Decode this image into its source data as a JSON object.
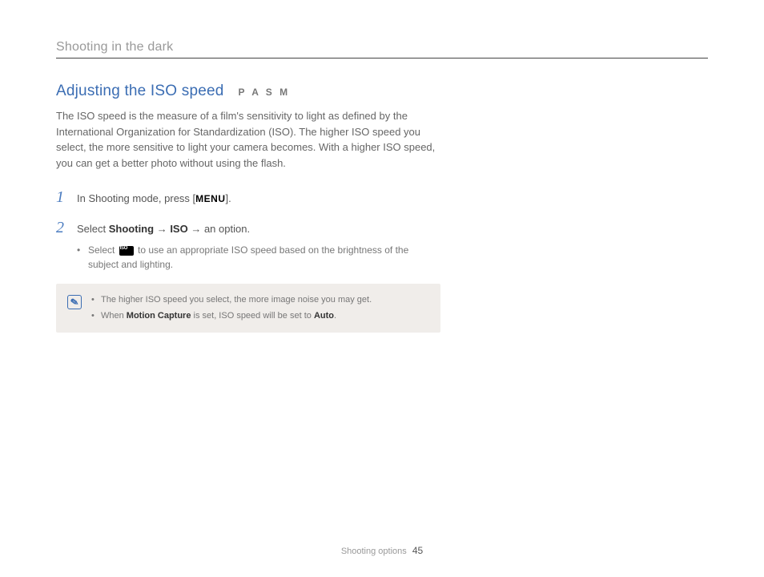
{
  "header": {
    "title": "Shooting in the dark"
  },
  "section": {
    "title": "Adjusting the ISO speed",
    "modes": "P A S M",
    "intro": "The ISO speed is the measure of a film's sensitivity to light as defined by the International Organization for Standardization (ISO). The higher ISO speed you select, the more sensitive to light your camera becomes. With a higher ISO speed, you can get a better photo without using the flash."
  },
  "steps": {
    "s1": {
      "num": "1",
      "text_a": "In Shooting mode, press [",
      "menu": "MENU",
      "text_b": "]."
    },
    "s2": {
      "num": "2",
      "text_a": "Select ",
      "b1": "Shooting",
      "arrow1": " → ",
      "b2": "ISO",
      "arrow2": " → ",
      "text_b": "an option.",
      "sub_a": "Select ",
      "sub_b": " to use an appropriate ISO speed based on the brightness of the subject and lighting."
    }
  },
  "note": {
    "n1": "The higher ISO speed you select, the more image noise you may get.",
    "n2_a": "When ",
    "n2_b": "Motion Capture",
    "n2_c": " is set, ISO speed will be set to ",
    "n2_d": "Auto",
    "n2_e": "."
  },
  "footer": {
    "section": "Shooting options",
    "page": "45"
  }
}
